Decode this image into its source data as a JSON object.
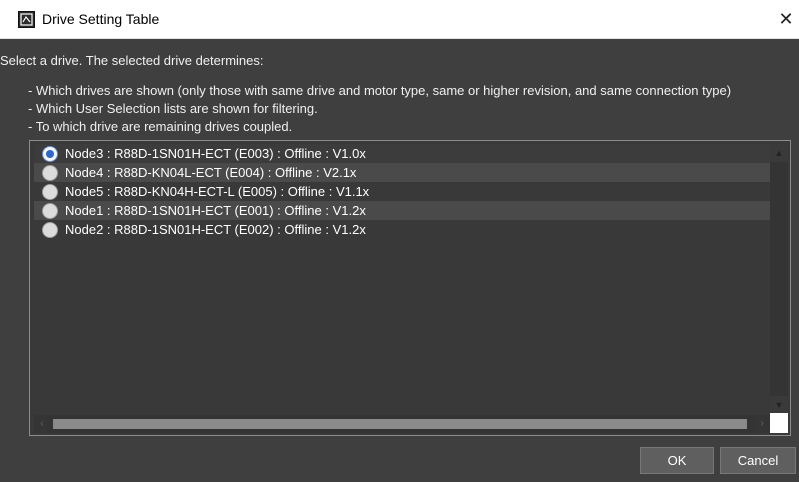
{
  "window": {
    "title": "Drive Setting Table",
    "close_glyph": "✕",
    "icon": "app-icon"
  },
  "instructions": {
    "heading": "Select a drive. The selected drive determines:",
    "items": [
      "- Which drives are shown (only those with same drive and motor type, same or higher revision, and same connection type)",
      "- Which User Selection lists are shown for filtering.",
      "- To which drive are remaining drives coupled."
    ]
  },
  "drives": [
    {
      "label": "Node3 : R88D-1SN01H-ECT (E003) : Offline : V1.0x",
      "selected": true
    },
    {
      "label": "Node4 : R88D-KN04L-ECT (E004) : Offline : V2.1x",
      "selected": false
    },
    {
      "label": "Node5 : R88D-KN04H-ECT-L (E005) : Offline : V1.1x",
      "selected": false
    },
    {
      "label": "Node1 : R88D-1SN01H-ECT (E001) : Offline : V1.2x",
      "selected": false
    },
    {
      "label": "Node2 : R88D-1SN01H-ECT (E002) : Offline : V1.2x",
      "selected": false
    }
  ],
  "buttons": {
    "ok": "OK",
    "cancel": "Cancel"
  },
  "colors": {
    "dialog_bg": "#3f3f3f",
    "radio_accent": "#2f66c8",
    "button_bg": "#5f5f5f"
  }
}
